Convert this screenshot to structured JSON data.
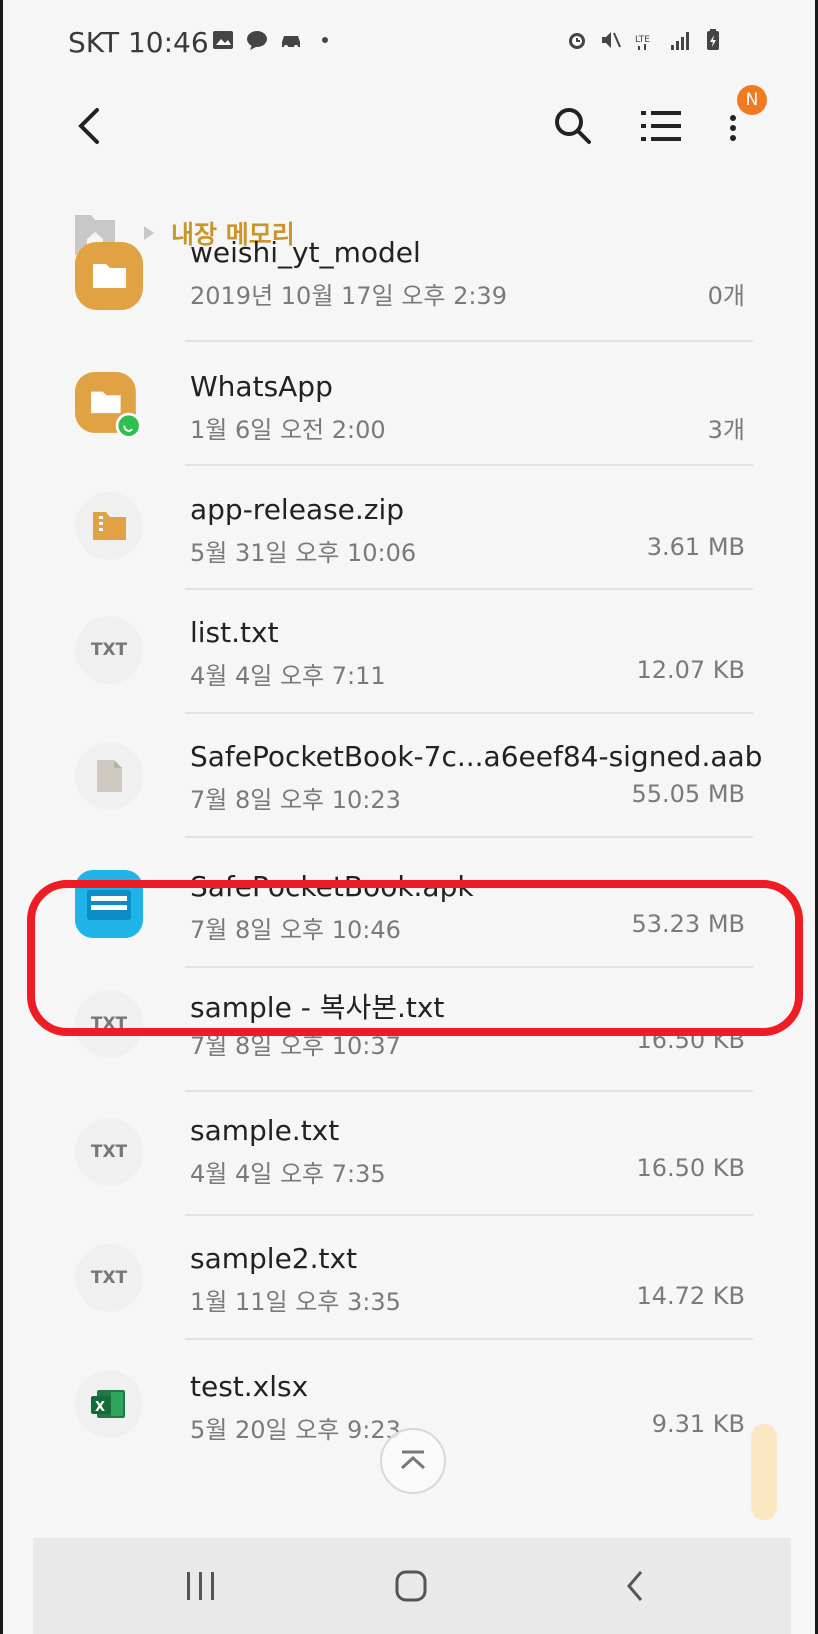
{
  "status_bar": {
    "carrier_time": "SKT 10:46",
    "notification_icons": [
      "gallery-icon",
      "talk-icon",
      "car-icon",
      "dot-icon"
    ],
    "system_icons": [
      "alarm-icon",
      "mute-icon",
      "lte-icon",
      "signal-icon",
      "battery-icon"
    ]
  },
  "app_bar": {
    "badge": "N"
  },
  "breadcrumb": {
    "label": "내장 메모리"
  },
  "files": [
    {
      "name": "weishi_yt_model",
      "date": "2019년 10월 17일 오후 2:39",
      "size": "0개",
      "type": "folder"
    },
    {
      "name": "WhatsApp",
      "date": "1월 6일 오전 2:00",
      "size": "3개",
      "type": "folder-whatsapp"
    },
    {
      "name": "app-release.zip",
      "date": "5월 31일 오후 10:06",
      "size": "3.61 MB",
      "type": "zip"
    },
    {
      "name": "list.txt",
      "date": "4월 4일 오후 7:11",
      "size": "12.07 KB",
      "type": "txt",
      "icon_label": "TXT"
    },
    {
      "name": "SafePocketBook-7c...a6eef84-signed.aab",
      "date": "7월 8일 오후 10:23",
      "size": "55.05 MB",
      "type": "file"
    },
    {
      "name": "SafePocketBook.apk",
      "date": "7월 8일 오후 10:46",
      "size": "53.23 MB",
      "type": "apk"
    },
    {
      "name": "sample - 복사본.txt",
      "date": "7월 8일 오후 10:37",
      "size": "16.50 KB",
      "type": "txt",
      "icon_label": "TXT"
    },
    {
      "name": "sample.txt",
      "date": "4월 4일 오후 7:35",
      "size": "16.50 KB",
      "type": "txt",
      "icon_label": "TXT"
    },
    {
      "name": "sample2.txt",
      "date": "1월 11일 오후 3:35",
      "size": "14.72 KB",
      "type": "txt",
      "icon_label": "TXT"
    },
    {
      "name": "test.xlsx",
      "date": "5월 20일 오후 9:23",
      "size": "9.31 KB",
      "type": "xlsx"
    }
  ],
  "colors": {
    "accent": "#c9962c",
    "folder": "#e0a243",
    "highlight": "#ee1c25",
    "badge": "#ef7a22"
  }
}
